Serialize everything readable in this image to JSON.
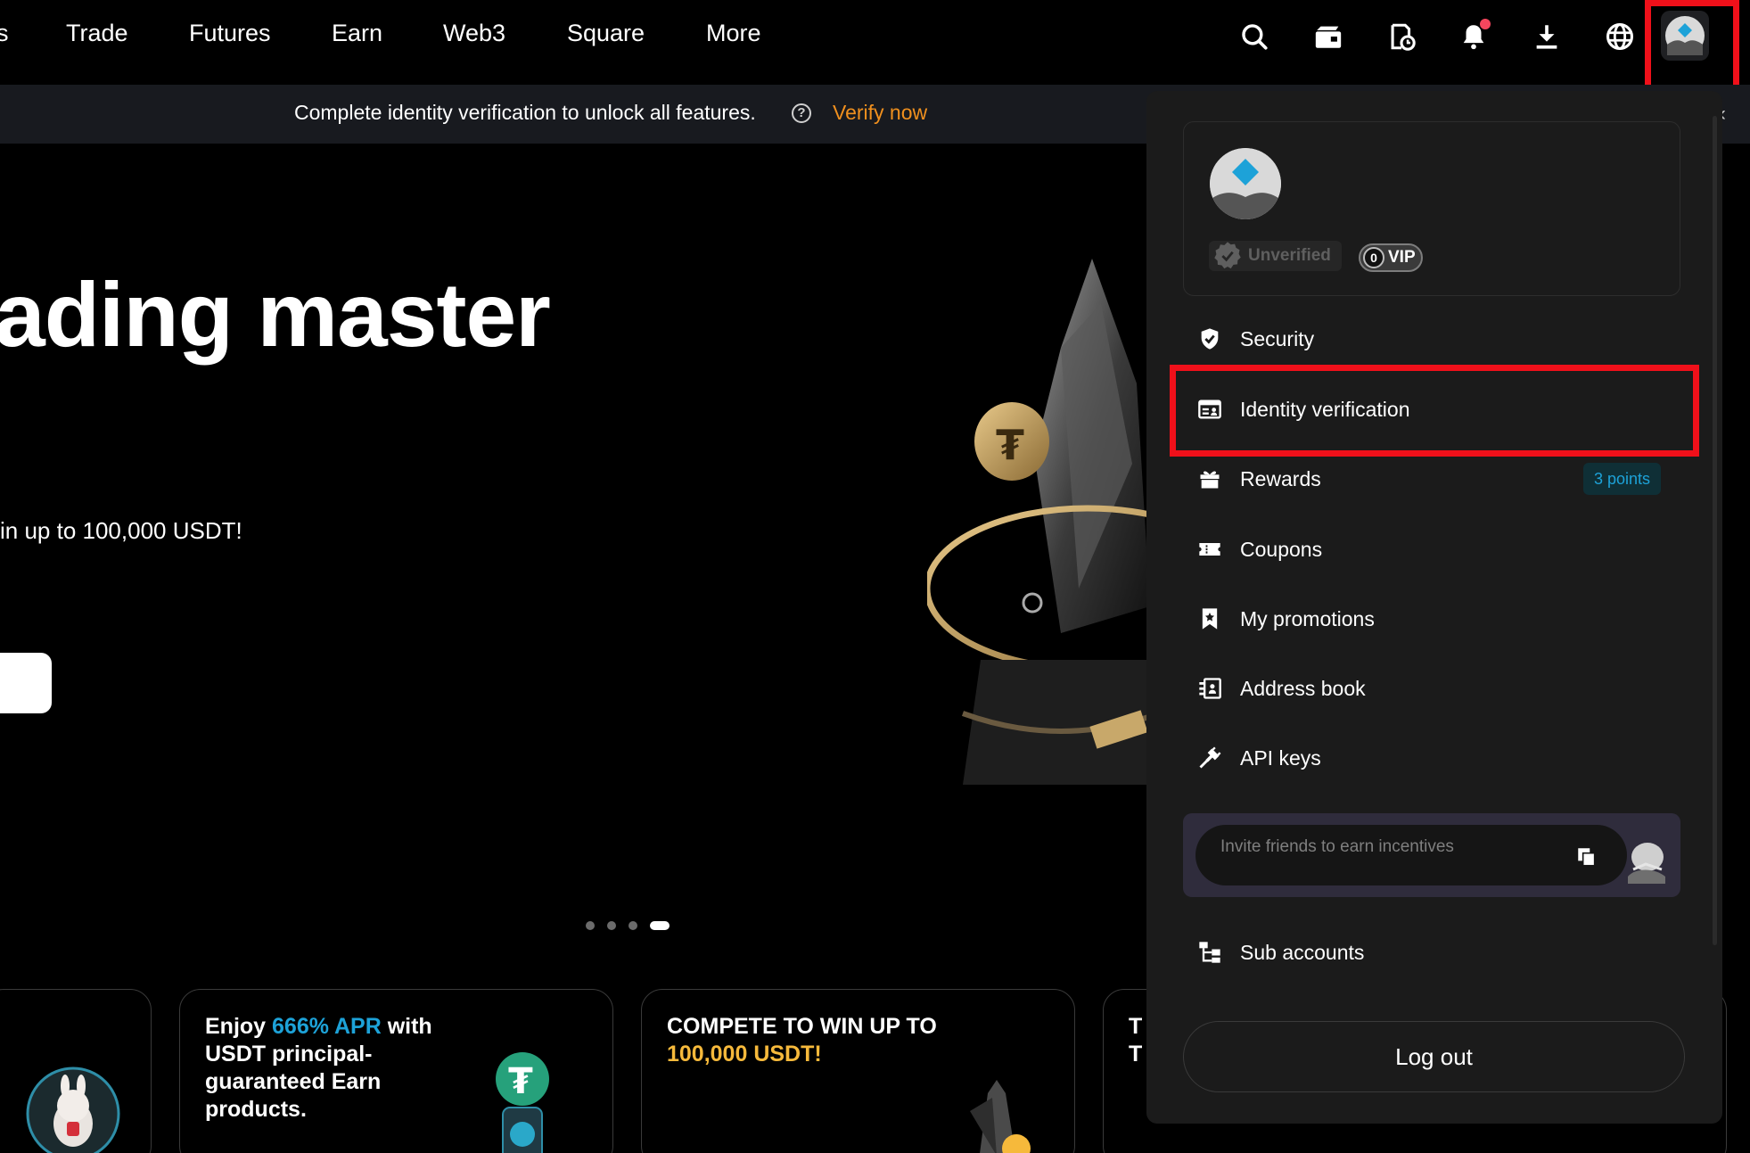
{
  "nav": {
    "partial_left": "s",
    "items": [
      {
        "label": "Trade"
      },
      {
        "label": "Futures"
      },
      {
        "label": "Earn"
      },
      {
        "label": "Web3"
      },
      {
        "label": "Square"
      },
      {
        "label": "More"
      }
    ],
    "icons": [
      "search-icon",
      "wallet-icon",
      "orders-history-icon",
      "bell-icon",
      "download-icon",
      "globe-icon",
      "avatar-icon"
    ],
    "notification_dot_color": "#f6465d"
  },
  "banner": {
    "text": "Complete identity verification to unlock all features.",
    "help_glyph": "?",
    "link": "Verify now",
    "link_color": "#f0901e"
  },
  "hero": {
    "title": "ading master",
    "subtitle": "in up to 100,000 USDT!",
    "carousel": {
      "count": 4,
      "active": 4
    }
  },
  "cards": [
    {
      "parts": []
    },
    {
      "parts": [
        "Enjoy ",
        "666% APR",
        " with USDT principal-guaranteed Earn products."
      ]
    },
    {
      "parts": [
        "COMPETE TO WIN UP TO ",
        "100,000 USDT!"
      ]
    },
    {
      "parts": [
        "T",
        "T"
      ]
    }
  ],
  "profile": {
    "unverified": "Unverified",
    "vip_level": "0",
    "vip_label": "VIP",
    "accent": "#1da2d8"
  },
  "menu": {
    "security": "Security",
    "identity": "Identity verification",
    "rewards": "Rewards",
    "rewards_badge": "3 points",
    "coupons": "Coupons",
    "promotions": "My promotions",
    "address_book": "Address book",
    "api_keys": "API keys",
    "sub_accounts": "Sub accounts",
    "logout": "Log out"
  },
  "invite": {
    "placeholder": "Invite friends to earn incentives"
  },
  "highlight_color": "#f0101a"
}
